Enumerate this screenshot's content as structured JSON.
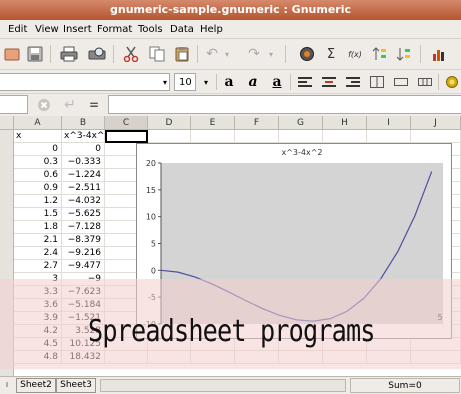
{
  "window": {
    "title": "gnumeric-sample.gnumeric : Gnumeric"
  },
  "menu": {
    "items": [
      "Edit",
      "View",
      "Insert",
      "Format",
      "Tools",
      "Data",
      "Help"
    ]
  },
  "toolbar": {
    "icons": [
      "new-icon",
      "save-icon",
      "print-icon",
      "print-preview-icon",
      "cut-icon",
      "copy-icon",
      "paste-icon",
      "undo-icon",
      "redo-icon",
      "hyperlink-icon",
      "sum-icon",
      "function-icon",
      "sort-ascending-icon",
      "sort-descending-icon",
      "chart-icon"
    ],
    "font_size": "10",
    "font_size_options": [
      "10"
    ]
  },
  "formula_bar": {
    "equals": "=",
    "value": ""
  },
  "columns": [
    "A",
    "B",
    "C",
    "D",
    "E",
    "F",
    "G",
    "H",
    "I",
    "J"
  ],
  "rows": [
    {
      "a": "x",
      "b": "x^3-4x^2"
    },
    {
      "a": "0",
      "b": "0"
    },
    {
      "a": "0.3",
      "b": "−0.333"
    },
    {
      "a": "0.6",
      "b": "−1.224"
    },
    {
      "a": "0.9",
      "b": "−2.511"
    },
    {
      "a": "1.2",
      "b": "−4.032"
    },
    {
      "a": "1.5",
      "b": "−5.625"
    },
    {
      "a": "1.8",
      "b": "−7.128"
    },
    {
      "a": "2.1",
      "b": "−8.379"
    },
    {
      "a": "2.4",
      "b": "−9.216"
    },
    {
      "a": "2.7",
      "b": "−9.477"
    },
    {
      "a": "3",
      "b": "−9"
    },
    {
      "a": "3.3",
      "b": "−7.623"
    },
    {
      "a": "3.6",
      "b": "−5.184"
    },
    {
      "a": "3.9",
      "b": "−1.521"
    },
    {
      "a": "4.2",
      "b": "3.528"
    },
    {
      "a": "4.5",
      "b": "10.125"
    },
    {
      "a": "4.8",
      "b": "18.432"
    }
  ],
  "chart_data": {
    "type": "line",
    "title": "x^3-4x^2",
    "x": [
      0,
      0.3,
      0.6,
      0.9,
      1.2,
      1.5,
      1.8,
      2.1,
      2.4,
      2.7,
      3,
      3.3,
      3.6,
      3.9,
      4.2,
      4.5,
      4.8
    ],
    "series": [
      {
        "values": [
          0,
          -0.333,
          -1.224,
          -2.511,
          -4.032,
          -5.625,
          -7.128,
          -8.379,
          -9.216,
          -9.477,
          -9,
          -7.623,
          -5.184,
          -1.521,
          3.528,
          10.125,
          18.432
        ]
      }
    ],
    "ylim": [
      -10,
      20
    ],
    "yticks": [
      "20",
      "15",
      "10",
      "5",
      "0",
      "-5",
      "-10"
    ],
    "xtick_visible": "5",
    "xlim": [
      0,
      5
    ],
    "plot_bg": "#d4d4d4",
    "line_color": "#4f4fa0",
    "grid": false
  },
  "sheets": [
    "Sheet2",
    "Sheet3"
  ],
  "status": {
    "sum": "Sum=0"
  },
  "overlay_text": "Spreadsheet programs",
  "colors": {
    "title_bar": "#c46a43",
    "selection_band": "#f4cdcd"
  }
}
